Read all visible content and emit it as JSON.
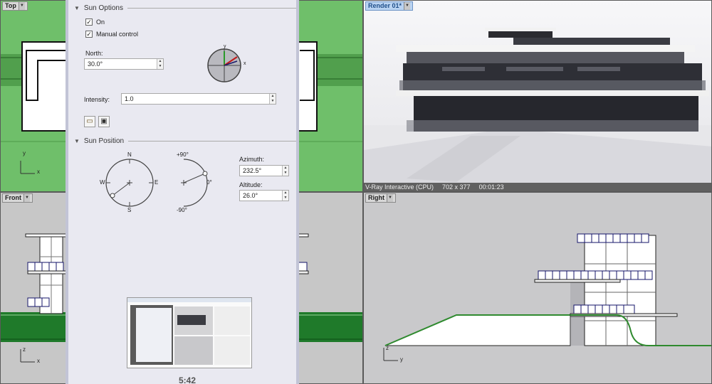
{
  "viewports": {
    "top_label": "Top",
    "front_label": "Front",
    "render_label": "Render 01*",
    "right_label": "Right",
    "axis_x": "x",
    "axis_y": "y",
    "axis_z": "z"
  },
  "render_status": {
    "engine": "V-Ray Interactive (CPU)",
    "resolution": "702 x 377",
    "elapsed": "00:01:23"
  },
  "sun_options": {
    "header": "Sun Options",
    "on_label": "On",
    "on_checked": true,
    "manual_label": "Manual control",
    "manual_checked": true,
    "north_label": "North:",
    "north_value": "30.0°",
    "intensity_label": "Intensity:",
    "intensity_value": "1.0",
    "gizmo_x": "x",
    "gizmo_y": "y"
  },
  "sun_position": {
    "header": "Sun Position",
    "compass": {
      "n": "N",
      "s": "S",
      "e": "E",
      "w": "W"
    },
    "altitude_dial": {
      "top": "+90°",
      "mid": "0°",
      "bottom": "-90°"
    },
    "azimuth_label": "Azimuth:",
    "azimuth_value": "232.5°",
    "altitude_label": "Altitude:",
    "altitude_value": "26.0°"
  },
  "video_overlay": {
    "time": "5:42"
  },
  "colors": {
    "top_bg": "#6fbf6a",
    "panel_bg": "#e9e9f1",
    "active_tab": "#b9d3f2"
  }
}
